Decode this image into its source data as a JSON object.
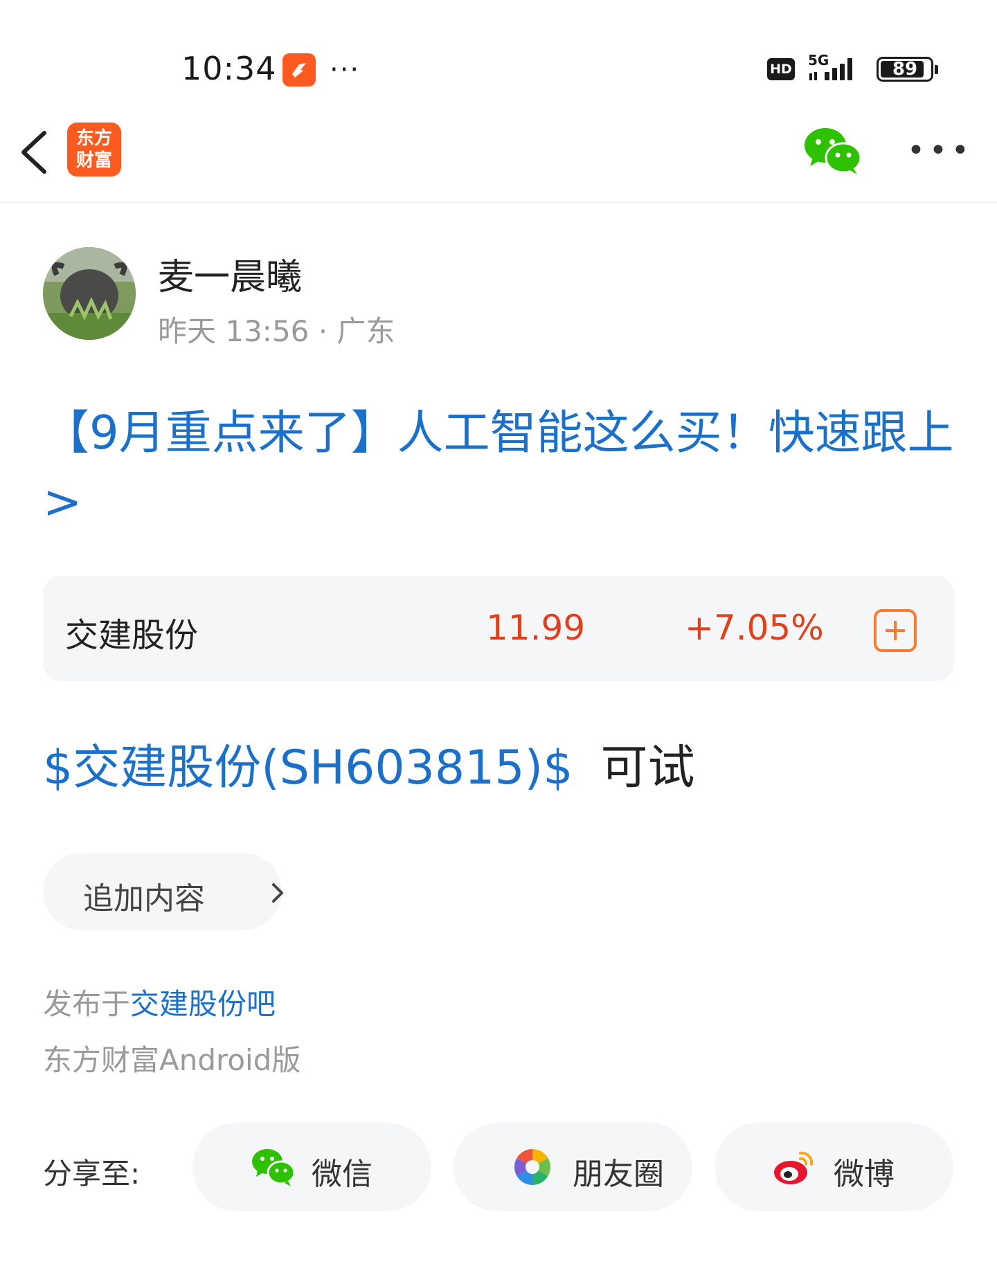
{
  "status_bar": {
    "time": "10:34",
    "more_dots": "···",
    "hd_label": "HD",
    "network_label": "5G",
    "battery_level": "89",
    "battery_fraction": 0.89
  },
  "nav": {
    "logo_line1": "东方",
    "logo_line2": "财富",
    "more_dots": "•••"
  },
  "author": {
    "name": "麦一晨曦",
    "meta": "昨天 13:56 · 广东"
  },
  "post": {
    "title": "【9月重点来了】人工智能这么买！快速跟上>",
    "stock_link": "$交建股份(SH603815)$",
    "body_text": "可试"
  },
  "stock_card": {
    "name": "交建股份",
    "price": "11.99",
    "change": "+7.05%"
  },
  "append": {
    "label": "追加内容"
  },
  "published": {
    "prefix": "发布于",
    "bar_name": "交建股份吧",
    "client": "东方财富Android版"
  },
  "share": {
    "label": "分享至:",
    "wechat": "微信",
    "moments": "朋友圈",
    "weibo": "微博"
  },
  "colors": {
    "link_blue": "#1b70c9",
    "up_red": "#e0401c",
    "brand_orange": "#ff5a1f",
    "wechat_green": "#2dc100"
  }
}
